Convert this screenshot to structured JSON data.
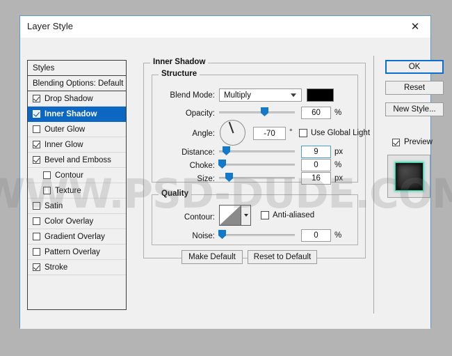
{
  "window": {
    "title": "Layer Style",
    "close_icon": "close-icon"
  },
  "watermark": {
    "text": "WWW.PSD-DUDE.COM"
  },
  "styles_panel": {
    "header_label": "Styles",
    "items": [
      {
        "label": "Blending Options: Default",
        "checkbox": false,
        "has_checkbox": false,
        "selected": false,
        "sub": false
      },
      {
        "label": "Drop Shadow",
        "checkbox": true,
        "has_checkbox": true,
        "selected": false,
        "sub": false
      },
      {
        "label": "Inner Shadow",
        "checkbox": true,
        "has_checkbox": true,
        "selected": true,
        "sub": false
      },
      {
        "label": "Outer Glow",
        "checkbox": false,
        "has_checkbox": true,
        "selected": false,
        "sub": false
      },
      {
        "label": "Inner Glow",
        "checkbox": true,
        "has_checkbox": true,
        "selected": false,
        "sub": false
      },
      {
        "label": "Bevel and Emboss",
        "checkbox": true,
        "has_checkbox": true,
        "selected": false,
        "sub": false
      },
      {
        "label": "Contour",
        "checkbox": false,
        "has_checkbox": true,
        "selected": false,
        "sub": true
      },
      {
        "label": "Texture",
        "checkbox": false,
        "has_checkbox": true,
        "selected": false,
        "sub": true
      },
      {
        "label": "Satin",
        "checkbox": false,
        "has_checkbox": true,
        "selected": false,
        "sub": false
      },
      {
        "label": "Color Overlay",
        "checkbox": false,
        "has_checkbox": true,
        "selected": false,
        "sub": false
      },
      {
        "label": "Gradient Overlay",
        "checkbox": false,
        "has_checkbox": true,
        "selected": false,
        "sub": false
      },
      {
        "label": "Pattern Overlay",
        "checkbox": false,
        "has_checkbox": true,
        "selected": false,
        "sub": false
      },
      {
        "label": "Stroke",
        "checkbox": true,
        "has_checkbox": true,
        "selected": false,
        "sub": false
      }
    ]
  },
  "effect": {
    "group_title": "Inner Shadow",
    "structure": {
      "group_title": "Structure",
      "blend_mode_label": "Blend Mode:",
      "blend_mode_value": "Multiply",
      "color_swatch": "#000000",
      "opacity_label": "Opacity:",
      "opacity_value": "60",
      "opacity_unit": "%",
      "angle_label": "Angle:",
      "angle_value": "-70",
      "angle_unit": "°",
      "use_global_light_label": "Use Global Light",
      "use_global_light_checked": false,
      "distance_label": "Distance:",
      "distance_value": "9",
      "distance_unit": "px",
      "choke_label": "Choke:",
      "choke_value": "0",
      "choke_unit": "%",
      "size_label": "Size:",
      "size_value": "16",
      "size_unit": "px"
    },
    "quality": {
      "group_title": "Quality",
      "contour_label": "Contour:",
      "anti_aliased_label": "Anti-aliased",
      "anti_aliased_checked": false,
      "noise_label": "Noise:",
      "noise_value": "0",
      "noise_unit": "%"
    },
    "make_default_label": "Make Default",
    "reset_to_default_label": "Reset to Default"
  },
  "buttons": {
    "ok": "OK",
    "reset": "Reset",
    "new_style": "New Style...",
    "preview_label": "Preview",
    "preview_checked": true
  },
  "colors": {
    "accent": "#0b67c2",
    "slider_thumb": "#1479c9",
    "dialog_border": "#5b9bd5",
    "preview_glow": "#2fd0a6"
  }
}
